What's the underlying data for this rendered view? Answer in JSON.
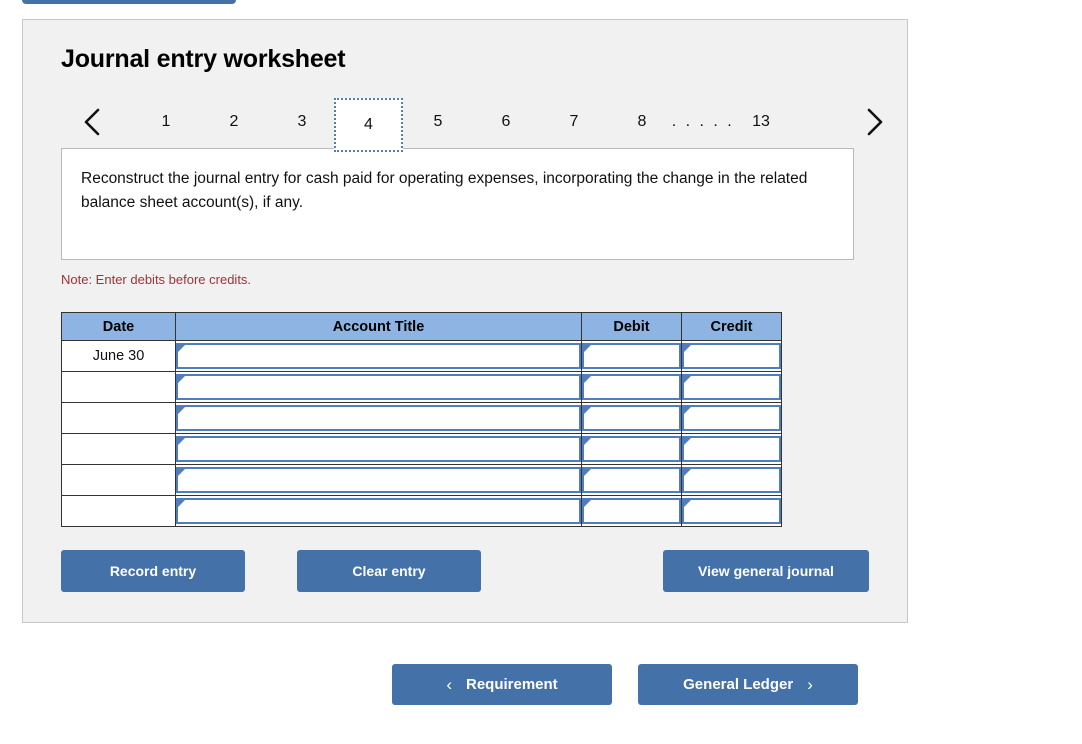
{
  "top_tab": {
    "name": "active-tab-strip"
  },
  "panel": {
    "title": "Journal entry worksheet",
    "pager": {
      "prev_icon": "chevron-left-icon",
      "next_icon": "chevron-right-icon",
      "pages": [
        "1",
        "2",
        "3",
        "4",
        "5",
        "6",
        "7",
        "8",
        ". . . . .",
        "13"
      ],
      "active_page": "4"
    },
    "question": "Reconstruct the journal entry for cash paid for operating expenses, incorporating the change in the related balance sheet account(s), if any.",
    "note": "Note: Enter debits before credits.",
    "table": {
      "headers": [
        "Date",
        "Account Title",
        "Debit",
        "Credit"
      ],
      "rows": [
        {
          "date": "June 30",
          "account_title": "",
          "debit": "",
          "credit": ""
        },
        {
          "date": "",
          "account_title": "",
          "debit": "",
          "credit": ""
        },
        {
          "date": "",
          "account_title": "",
          "debit": "",
          "credit": ""
        },
        {
          "date": "",
          "account_title": "",
          "debit": "",
          "credit": ""
        },
        {
          "date": "",
          "account_title": "",
          "debit": "",
          "credit": ""
        },
        {
          "date": "",
          "account_title": "",
          "debit": "",
          "credit": ""
        }
      ]
    },
    "buttons": {
      "record_entry": "Record entry",
      "clear_entry": "Clear entry",
      "view_general_journal": "View general journal"
    }
  },
  "bottom_nav": {
    "requirement_label": "Requirement",
    "requirement_icon": "chevron-left-icon",
    "general_ledger_label": "General Ledger",
    "general_ledger_icon": "chevron-right-icon"
  },
  "colors": {
    "button_blue": "#4472a8",
    "table_header_blue": "#8db4e2",
    "input_border_blue": "#4f7dbd",
    "note_red": "#a33232",
    "panel_bg": "#f1f1f1"
  }
}
